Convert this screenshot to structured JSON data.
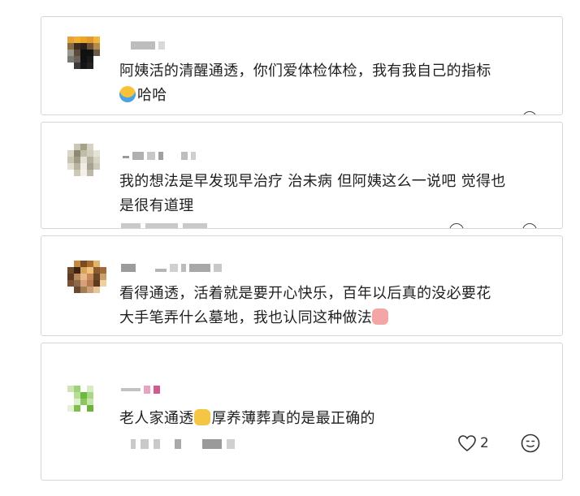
{
  "comments": [
    {
      "text": "阿姨活的清醒通透，你们爱体检体检，我有我自己的指标",
      "text_line2": "哈哈",
      "emoji": "laughing-tears-emoji"
    },
    {
      "text": "我的想法是早发现早治疗 治未病 但阿姨这么一说吧 觉得也",
      "text_line2": "是很有道理"
    },
    {
      "text": "看得通透，活着就是要开心快乐，百年以后真的没必要花",
      "text_line2": "大手笔弄什么墓地，我也认同这种做法",
      "emoji": "thumbs-up-emoji"
    },
    {
      "text_a": "老人家通透",
      "text_b": "厚养薄葬真的是最正确的",
      "emoji": "thumbs-up-emoji",
      "like_count": "2"
    }
  ],
  "icons": {
    "like": "heart-outline-icon",
    "reply": "smiley-face-icon"
  },
  "colors": {
    "border": "#d6d6d6",
    "text": "#1f1f1f",
    "blur": "#c9c9c9"
  }
}
